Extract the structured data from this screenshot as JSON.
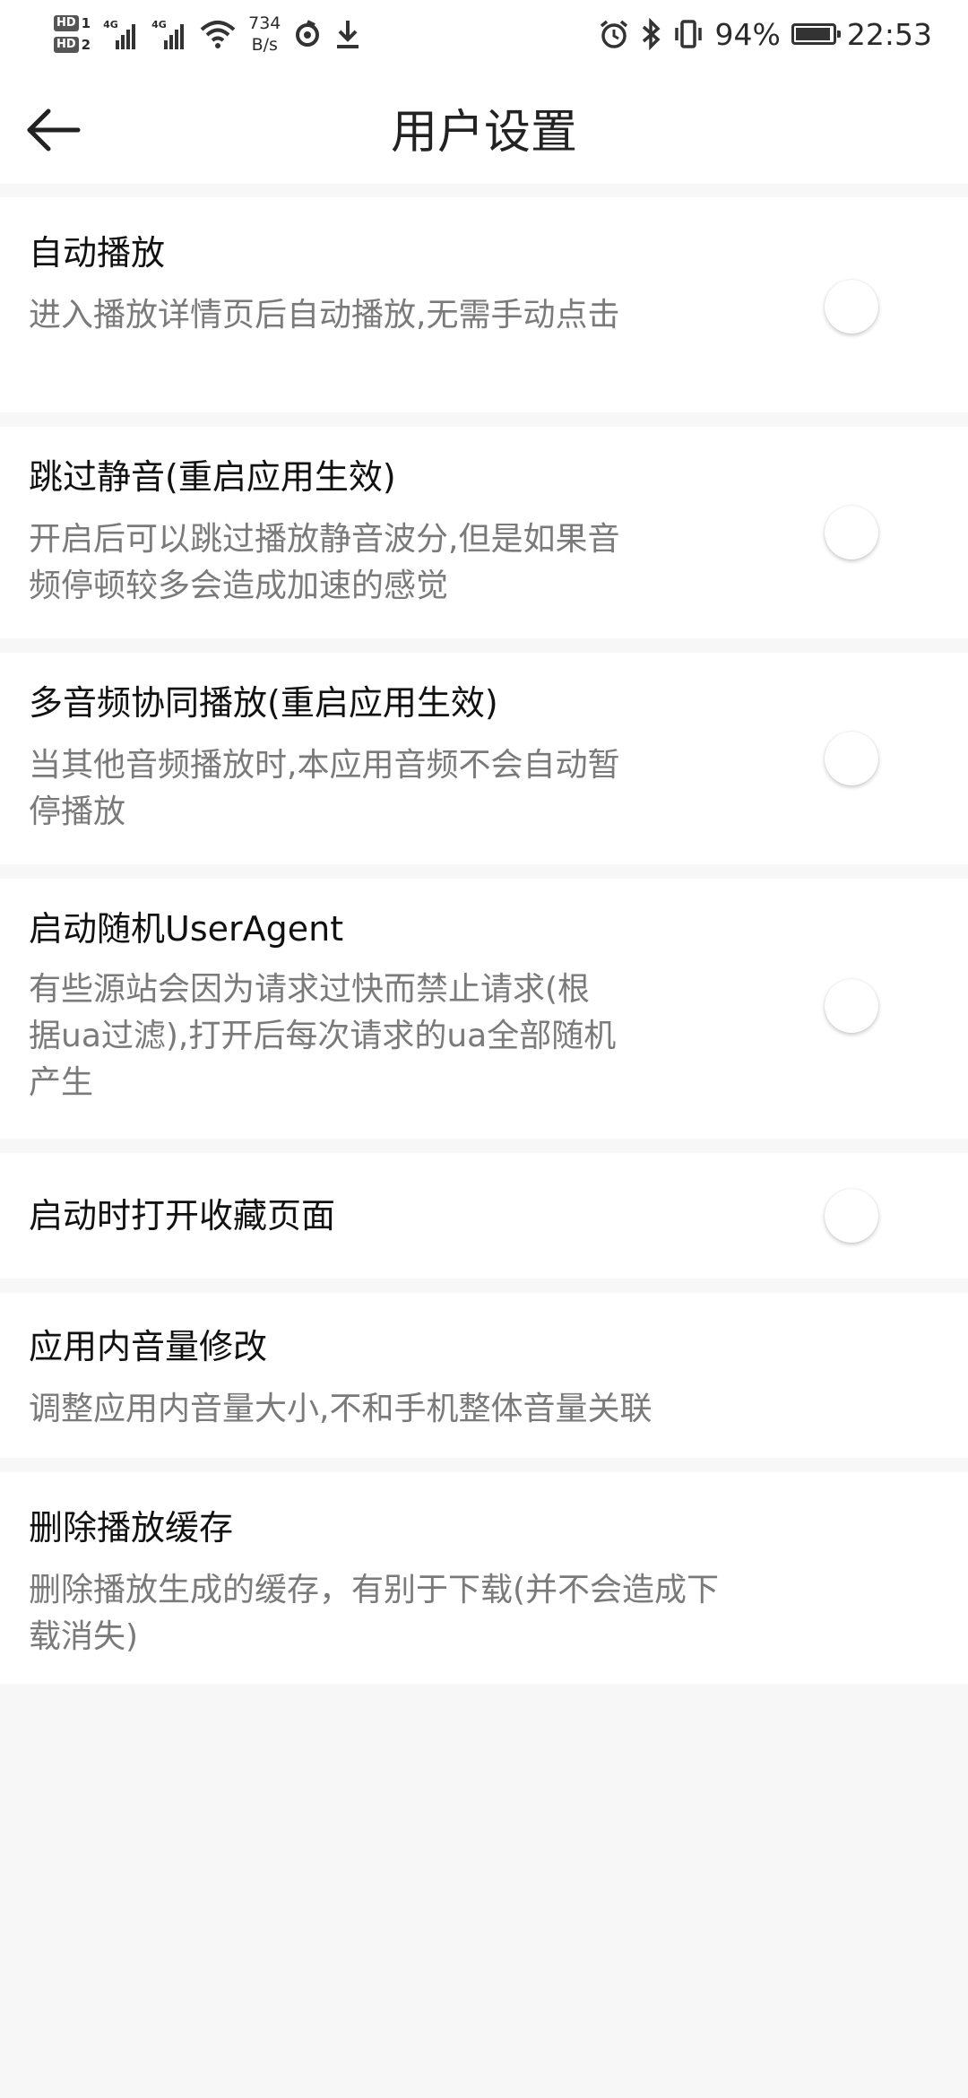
{
  "status_bar": {
    "hd1": "HD",
    "hd1_sub": "1",
    "hd2": "HD",
    "hd2_sub": "2",
    "net1": "4G",
    "net2": "4G",
    "speed_value": "734",
    "speed_unit": "B/s",
    "battery_percent": "94%",
    "battery_level": 0.94,
    "time": "22:53",
    "icons": [
      "wifi-icon",
      "sync-icon",
      "download-icon",
      "alarm-icon",
      "bluetooth-icon",
      "vibrate-icon",
      "battery-icon"
    ]
  },
  "header": {
    "back_icon": "arrow-left-icon",
    "title": "用户设置"
  },
  "settings": [
    {
      "title": "自动播放",
      "desc": "进入播放详情页后自动播放,无需手动点击",
      "toggle": false
    },
    {
      "title": "跳过静音(重启应用生效)",
      "desc": "开启后可以跳过播放静音波分,但是如果音频停顿较多会造成加速的感觉",
      "toggle": false
    },
    {
      "title": "多音频协同播放(重启应用生效)",
      "desc": "当其他音频播放时,本应用音频不会自动暂停播放",
      "toggle": false
    },
    {
      "title": "启动随机UserAgent",
      "desc": "有些源站会因为请求过快而禁止请求(根据ua过滤),打开后每次请求的ua全部随机产生",
      "toggle": false
    },
    {
      "title": "启动时打开收藏页面",
      "toggle": false
    },
    {
      "title": "应用内音量修改",
      "desc": "调整应用内音量大小,不和手机整体音量关联"
    },
    {
      "title": "删除播放缓存",
      "desc": "删除播放生成的缓存，有别于下载(并不会造成下载消失)"
    }
  ]
}
